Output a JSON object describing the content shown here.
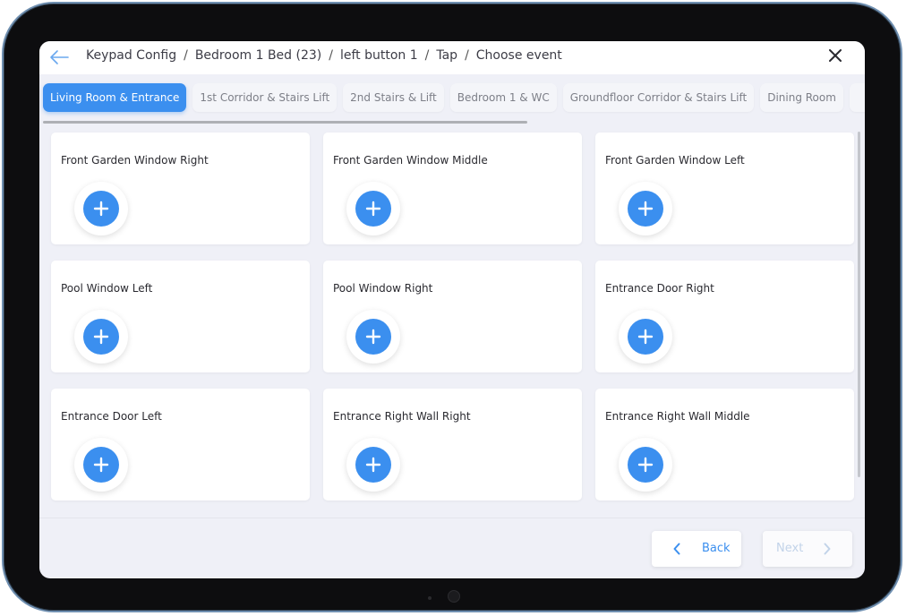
{
  "header": {
    "breadcrumb": [
      "Keypad Config",
      "Bedroom 1 Bed (23)",
      "left button 1",
      "Tap",
      "Choose event"
    ],
    "separator": "/"
  },
  "tabs": [
    {
      "label": "Living Room & Entrance",
      "active": true
    },
    {
      "label": "1st Corridor & Stairs Lift",
      "active": false
    },
    {
      "label": "2nd Stairs & Lift",
      "active": false
    },
    {
      "label": "Bedroom 1 & WC",
      "active": false
    },
    {
      "label": "Groundfloor Corridor & Stairs Lift",
      "active": false
    },
    {
      "label": "Dining Room",
      "active": false
    }
  ],
  "cards": [
    {
      "title": "Front Garden Window Right"
    },
    {
      "title": "Front Garden Window Middle"
    },
    {
      "title": "Front Garden Window Left"
    },
    {
      "title": "Pool Window Left"
    },
    {
      "title": "Pool Window Right"
    },
    {
      "title": "Entrance Door Right"
    },
    {
      "title": "Entrance Door Left"
    },
    {
      "title": "Entrance Right Wall Right"
    },
    {
      "title": "Entrance Right Wall Middle"
    }
  ],
  "footer": {
    "back_label": "Back",
    "next_label": "Next",
    "next_enabled": false
  },
  "colors": {
    "accent": "#3b8fef",
    "background": "#eff0f7",
    "card": "#ffffff"
  }
}
